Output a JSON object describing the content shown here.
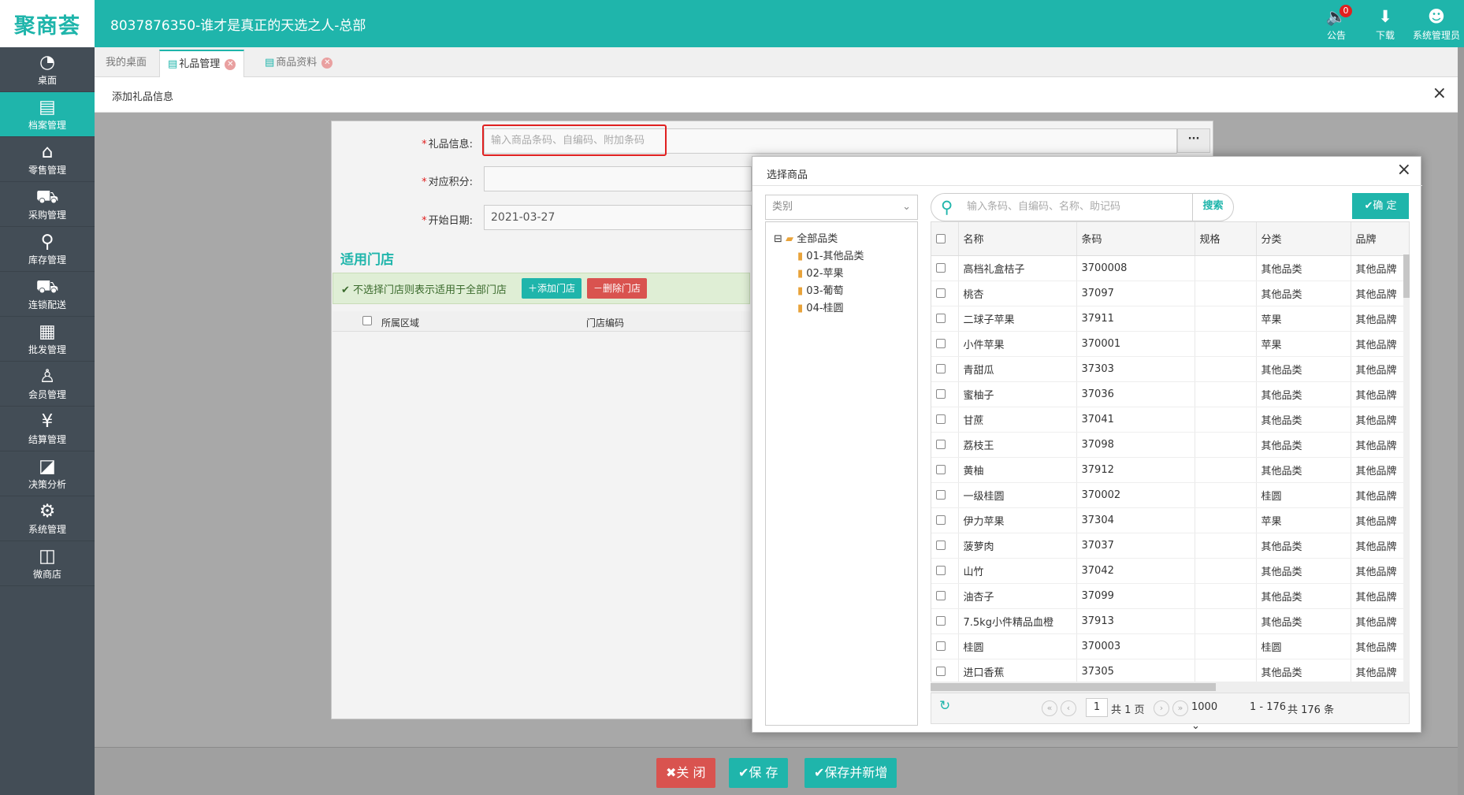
{
  "app": {
    "logo": "聚商荟",
    "title": "8037876350-谁才是真正的天选之人-总部"
  },
  "header_icons": [
    {
      "label": "公告",
      "badge": "0",
      "icon": "speaker-icon"
    },
    {
      "label": "下载",
      "icon": "download-icon"
    },
    {
      "label": "系统管理员",
      "icon": "avatar-icon"
    }
  ],
  "sidebar": {
    "items": [
      {
        "label": "桌面"
      },
      {
        "label": "档案管理"
      },
      {
        "label": "零售管理"
      },
      {
        "label": "采购管理"
      },
      {
        "label": "库存管理"
      },
      {
        "label": "连锁配送"
      },
      {
        "label": "批发管理"
      },
      {
        "label": "会员管理"
      },
      {
        "label": "结算管理"
      },
      {
        "label": "决策分析"
      },
      {
        "label": "系统管理"
      },
      {
        "label": "微商店"
      }
    ],
    "active": "档案管理"
  },
  "tabs": [
    {
      "label": "我的桌面"
    },
    {
      "label": "礼品管理"
    },
    {
      "label": "商品资料"
    }
  ],
  "panel": {
    "title": "添加礼品信息"
  },
  "form": {
    "gift_label": "礼品信息:",
    "gift_placeholder": "输入商品条码、自编码、附加条码",
    "points_label": "对应积分:",
    "start_label": "开始日期:",
    "start_value": "2021-03-27",
    "stores_title": "适用门店",
    "stores_hint": "不选择门店则表示适用于全部门店",
    "add_store": "添加门店",
    "del_store": "删除门店",
    "col_region": "所属区域",
    "col_store_code": "门店编码"
  },
  "buttons": {
    "close": "关 闭",
    "save": "保 存",
    "save_new": "保存并新增"
  },
  "dialog": {
    "title": "选择商品",
    "category_placeholder": "类别",
    "tree": [
      "全部品类",
      "01-其他品类",
      "02-苹果",
      "03-葡萄",
      "04-桂圆"
    ],
    "search_placeholder": "输入条码、自编码、名称、助记码",
    "search_button": "搜索",
    "confirm": "确 定",
    "columns": [
      "名称",
      "条码",
      "规格",
      "分类",
      "品牌"
    ],
    "rows": [
      [
        "高档礼盒桔子",
        "3700008",
        "",
        "其他品类",
        "其他品牌"
      ],
      [
        "桃杏",
        "37097",
        "",
        "其他品类",
        "其他品牌"
      ],
      [
        "二球子苹果",
        "37911",
        "",
        "苹果",
        "其他品牌"
      ],
      [
        "小件苹果",
        "370001",
        "",
        "苹果",
        "其他品牌"
      ],
      [
        "青甜瓜",
        "37303",
        "",
        "其他品类",
        "其他品牌"
      ],
      [
        "蜜柚子",
        "37036",
        "",
        "其他品类",
        "其他品牌"
      ],
      [
        "甘蔗",
        "37041",
        "",
        "其他品类",
        "其他品牌"
      ],
      [
        "荔枝王",
        "37098",
        "",
        "其他品类",
        "其他品牌"
      ],
      [
        "黄柚",
        "37912",
        "",
        "其他品类",
        "其他品牌"
      ],
      [
        "一级桂圆",
        "370002",
        "",
        "桂圆",
        "其他品牌"
      ],
      [
        "伊力苹果",
        "37304",
        "",
        "苹果",
        "其他品牌"
      ],
      [
        "菠萝肉",
        "37037",
        "",
        "其他品类",
        "其他品牌"
      ],
      [
        "山竹",
        "37042",
        "",
        "其他品类",
        "其他品牌"
      ],
      [
        "油杏子",
        "37099",
        "",
        "其他品类",
        "其他品牌"
      ],
      [
        "7.5kg小件精品血橙",
        "37913",
        "",
        "其他品类",
        "其他品牌"
      ],
      [
        "桂圆",
        "370003",
        "",
        "桂圆",
        "其他品牌"
      ],
      [
        "进口香蕉",
        "37305",
        "",
        "其他品类",
        "其他品牌"
      ]
    ],
    "pager": {
      "page": "1",
      "total_pages": "共 1 页",
      "page_size": "1000",
      "range": "1 - 176",
      "total": "共 176 条"
    }
  },
  "colors": {
    "accent": "#1fb5ab",
    "danger": "#d9534f",
    "highlight": "#e02020"
  }
}
